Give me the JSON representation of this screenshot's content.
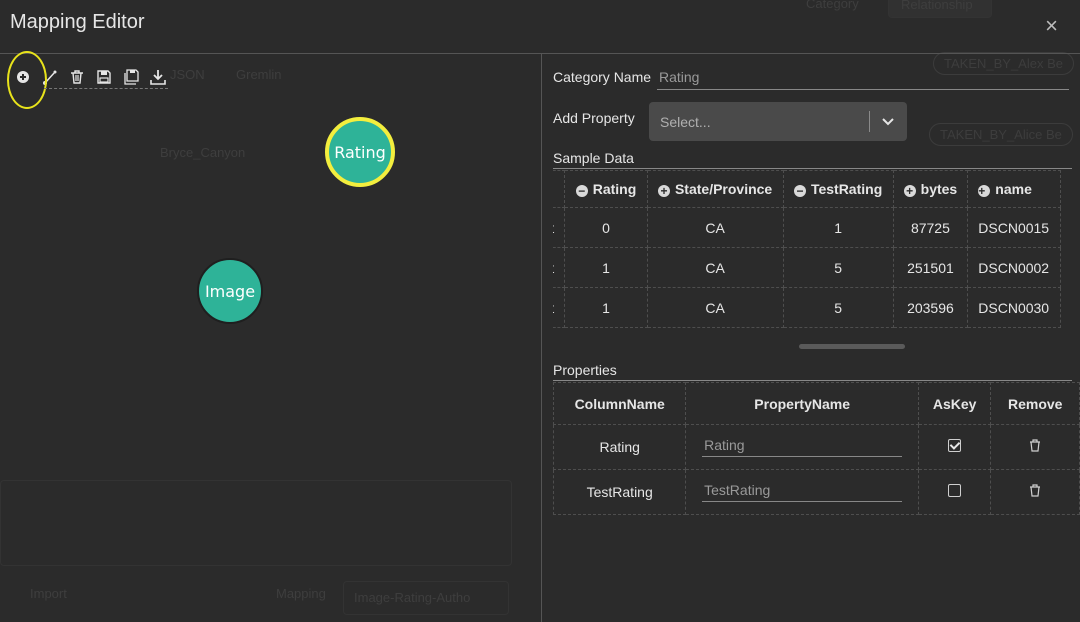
{
  "window": {
    "title": "Mapping Editor",
    "close_glyph": "×"
  },
  "toolbar": {
    "icons": [
      "plus-circle-icon",
      "link-icon",
      "trash-icon",
      "save-icon",
      "save-all-icon",
      "download-icon"
    ]
  },
  "nodes": {
    "rating": "Rating",
    "image": "Image"
  },
  "right": {
    "category_label": "Category Name",
    "category_value": "Rating",
    "add_property_label": "Add Property",
    "select_placeholder": "Select...",
    "sample_label": "Sample Data",
    "sample_headers": [
      {
        "label": "",
        "op": ""
      },
      {
        "label": "Rating",
        "op": "−"
      },
      {
        "label": "State/Province",
        "op": "+"
      },
      {
        "label": "TestRating",
        "op": "−"
      },
      {
        "label": "bytes",
        "op": "+"
      },
      {
        "label": "name",
        "op": "+"
      }
    ],
    "sample_rows": [
      [
        "t",
        "0",
        "CA",
        "1",
        "87725",
        "DSCN0015"
      ],
      [
        "t",
        "1",
        "CA",
        "5",
        "251501",
        "DSCN0002"
      ],
      [
        "t",
        "1",
        "CA",
        "5",
        "203596",
        "DSCN0030"
      ]
    ],
    "properties_label": "Properties",
    "properties_headers": [
      "ColumnName",
      "PropertyName",
      "AsKey",
      "Remove"
    ],
    "properties_rows": [
      {
        "column": "Rating",
        "property": "Rating",
        "askey": true
      },
      {
        "column": "TestRating",
        "property": "TestRating",
        "askey": false
      }
    ]
  },
  "background": {
    "text": [
      "Category",
      "Relationship",
      "TAKEN_BY_Alex Be",
      "TAKEN_BY_Alice Be",
      "JSON",
      "Gremlin",
      "Bryce_Canyon",
      "Import",
      "Mapping",
      "Image-Rating-Autho"
    ]
  },
  "colors": {
    "node": "#2eb398",
    "highlight": "#f3ee3e",
    "annotation": "#e8e31b"
  }
}
